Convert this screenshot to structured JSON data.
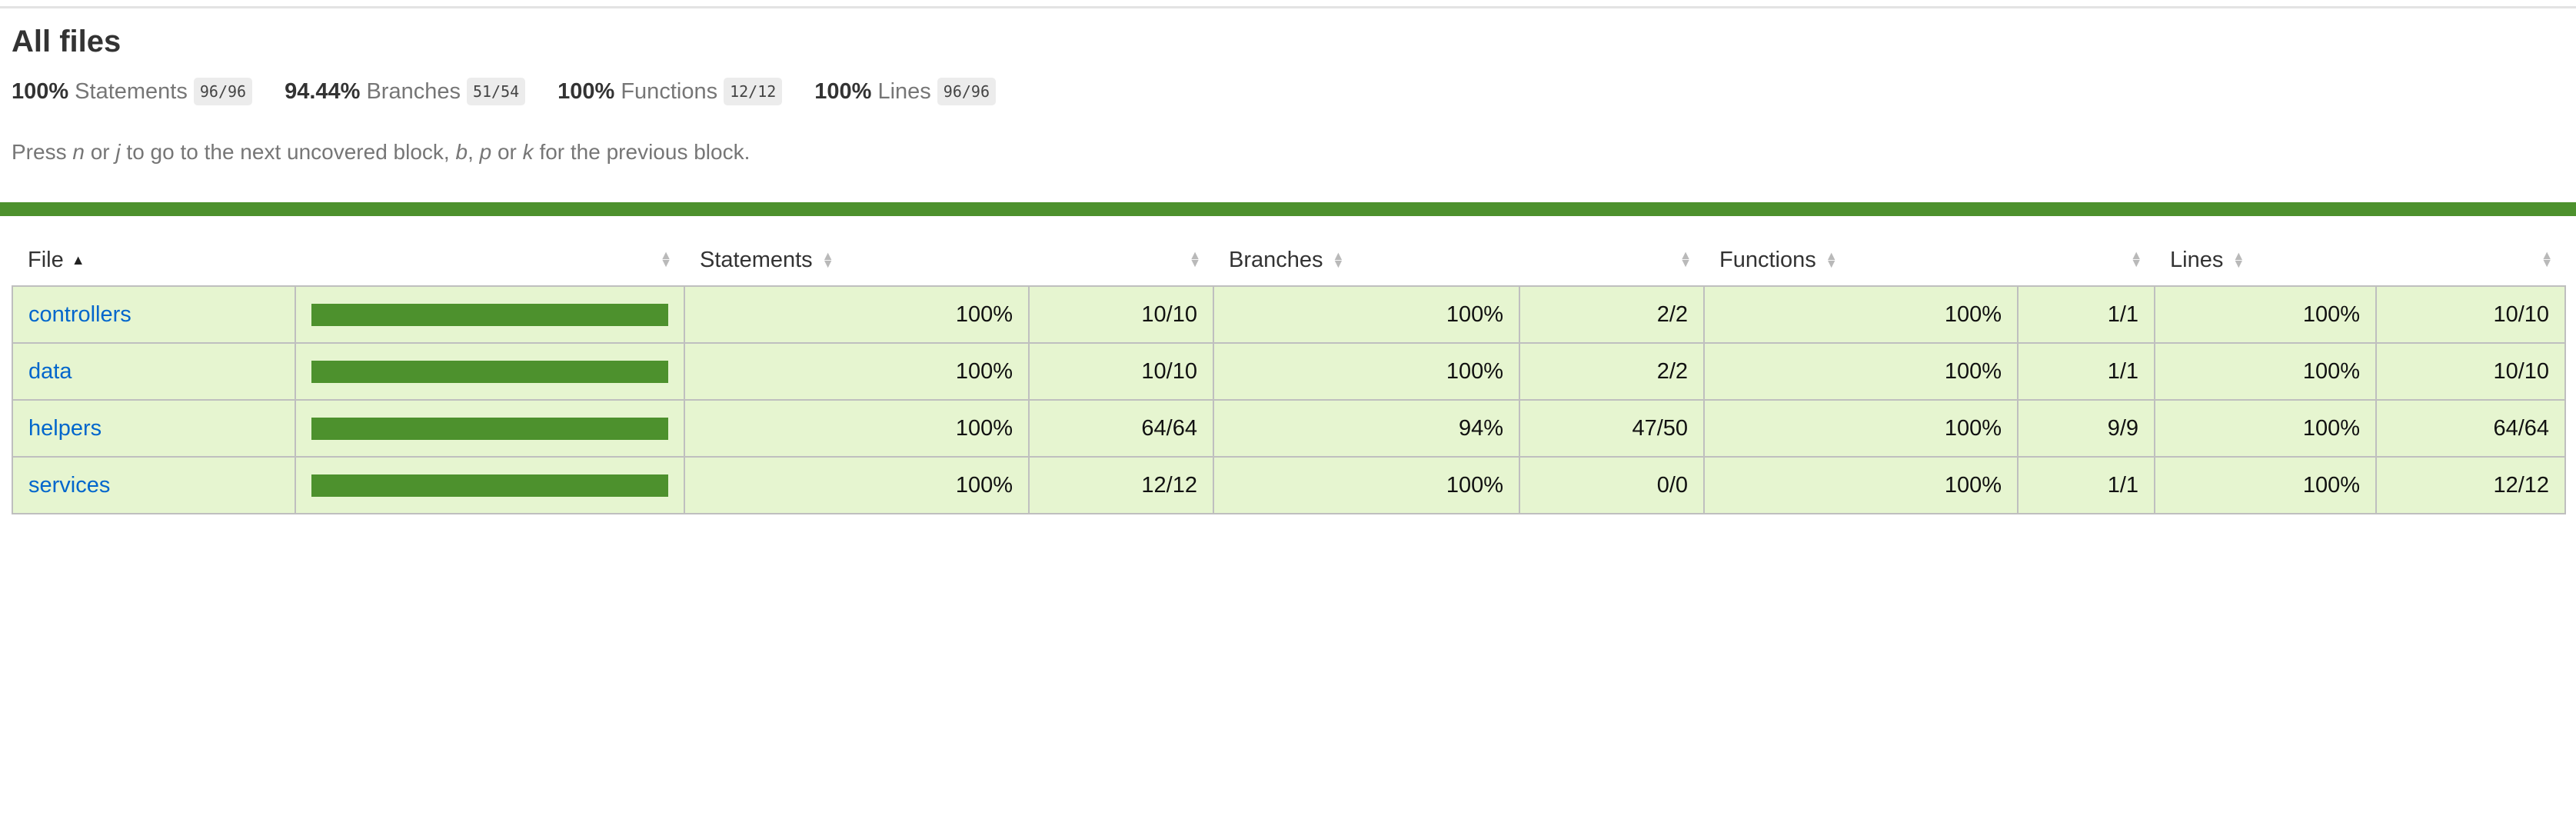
{
  "page": {
    "title": "All files",
    "hint_prefix": "Press ",
    "hint_n": "n",
    "hint_or": " or ",
    "hint_j": "j",
    "hint_middle": " to go to the next uncovered block, ",
    "hint_b": "b",
    "hint_comma": ", ",
    "hint_p": "p",
    "hint_or2": " or ",
    "hint_k": "k",
    "hint_suffix": " for the previous block."
  },
  "summary": [
    {
      "pct": "100%",
      "label": "Statements",
      "fraction": "96/96"
    },
    {
      "pct": "94.44%",
      "label": "Branches",
      "fraction": "51/54"
    },
    {
      "pct": "100%",
      "label": "Functions",
      "fraction": "12/12"
    },
    {
      "pct": "100%",
      "label": "Lines",
      "fraction": "96/96"
    }
  ],
  "colors": {
    "status_high": "#4d912d",
    "row_high": "#e6f5d0",
    "link": "#0066cc"
  },
  "table": {
    "headers": {
      "file": "File",
      "statements": "Statements",
      "branches": "Branches",
      "functions": "Functions",
      "lines": "Lines"
    },
    "rows": [
      {
        "file": "controllers",
        "coverage": 1.0,
        "statements_pct": "100%",
        "statements": "10/10",
        "branches_pct": "100%",
        "branches": "2/2",
        "functions_pct": "100%",
        "functions": "1/1",
        "lines_pct": "100%",
        "lines": "10/10"
      },
      {
        "file": "data",
        "coverage": 1.0,
        "statements_pct": "100%",
        "statements": "10/10",
        "branches_pct": "100%",
        "branches": "2/2",
        "functions_pct": "100%",
        "functions": "1/1",
        "lines_pct": "100%",
        "lines": "10/10"
      },
      {
        "file": "helpers",
        "coverage": 1.0,
        "statements_pct": "100%",
        "statements": "64/64",
        "branches_pct": "94%",
        "branches": "47/50",
        "functions_pct": "100%",
        "functions": "9/9",
        "lines_pct": "100%",
        "lines": "64/64"
      },
      {
        "file": "services",
        "coverage": 1.0,
        "statements_pct": "100%",
        "statements": "12/12",
        "branches_pct": "100%",
        "branches": "0/0",
        "functions_pct": "100%",
        "functions": "1/1",
        "lines_pct": "100%",
        "lines": "12/12"
      }
    ]
  }
}
